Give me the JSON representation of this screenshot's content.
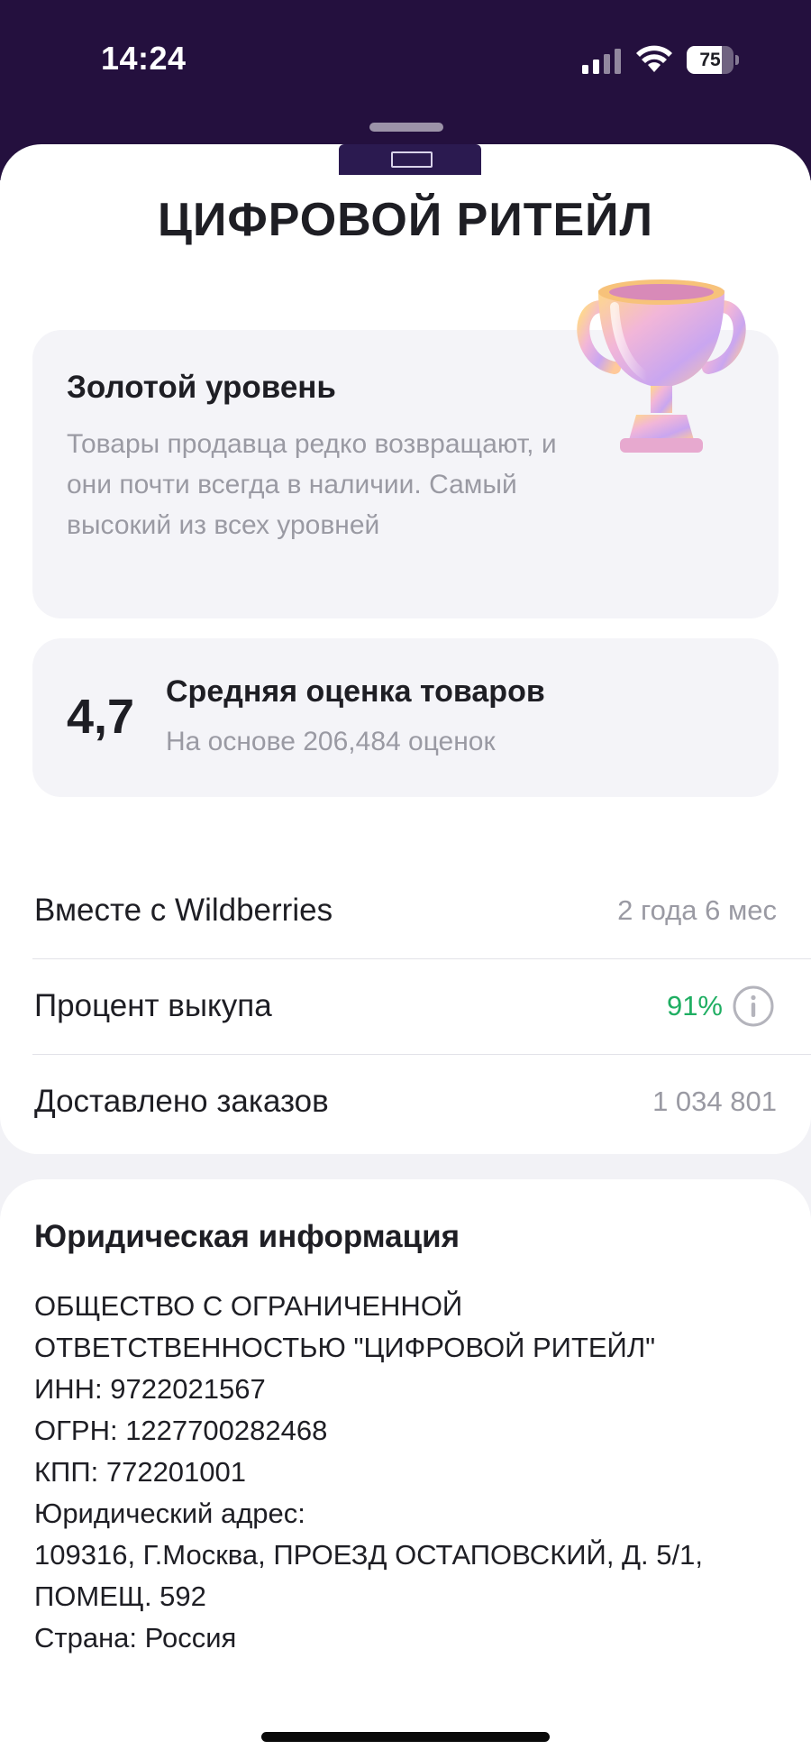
{
  "status_bar": {
    "time": "14:24",
    "battery_percent": "75",
    "battery_level": 0.75
  },
  "seller": {
    "name": "ЦИФРОВОЙ РИТЕЙЛ"
  },
  "level": {
    "title": "Золотой уровень",
    "description": "Товары продавца редко возвращают, и они почти всегда в наличии. Самый высокий из всех уровней",
    "icon": "trophy-icon"
  },
  "rating": {
    "value": "4,7",
    "title": "Средняя оценка товаров",
    "subtitle": "На основе 206,484 оценок"
  },
  "stats": [
    {
      "label": "Вместе с Wildberries",
      "value": "2 года 6 мес"
    },
    {
      "label": "Процент выкупа",
      "value": "91%"
    },
    {
      "label": "Доставлено заказов",
      "value": "1 034 801"
    }
  ],
  "legal": {
    "title": "Юридическая информация",
    "lines": [
      "ОБЩЕСТВО С ОГРАНИЧЕННОЙ",
      "ОТВЕТСТВЕННОСТЬЮ \"ЦИФРОВОЙ РИТЕЙЛ\"",
      "ИНН: 9722021567",
      "ОГРН: 1227700282468",
      "КПП: 772201001",
      "Юридический адрес:",
      "109316, Г.Москва, ПРОЕЗД ОСТАПОВСКИЙ, Д. 5/1,",
      "ПОМЕЩ. 592",
      "Страна: Россия"
    ]
  },
  "colors": {
    "app_background": "#24103e",
    "accent_green": "#1fae62",
    "muted_text": "#9a9aa3"
  }
}
